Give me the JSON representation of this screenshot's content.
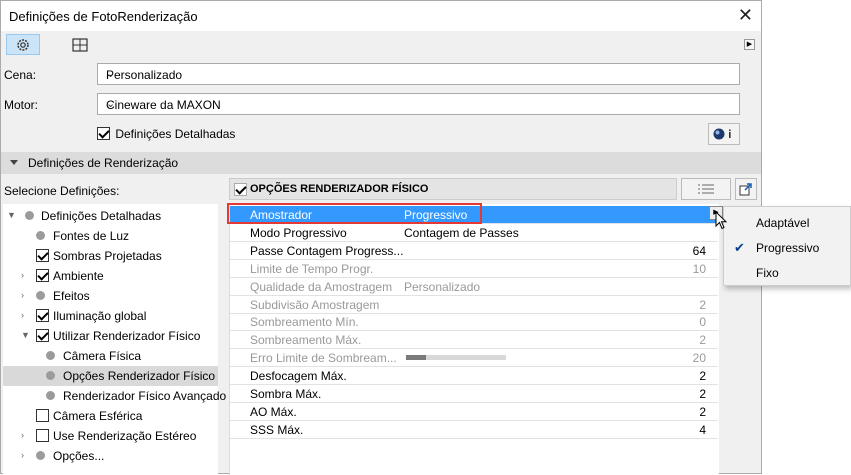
{
  "window": {
    "title": "Definições de FotoRenderização",
    "close_glyph": "✕"
  },
  "toolbar": {
    "icons": [
      "gear-icon",
      "viewport-icon"
    ],
    "scroll_glyph": "▶"
  },
  "scene": {
    "label": "Cena:",
    "value": "Personalizado"
  },
  "engine": {
    "label": "Motor:",
    "value": "Cineware da MAXON"
  },
  "detailed": {
    "label": "Definições Detalhadas",
    "checked": true
  },
  "section": {
    "title": "Definições de Renderização"
  },
  "select_label": "Selecione Definições:",
  "panel_header": {
    "title": "OPÇÕES RENDERIZADOR FÍSICO"
  },
  "tree": [
    {
      "label": "Definições Detalhadas",
      "type": "dot",
      "expander": "▼",
      "level": 0
    },
    {
      "label": "Fontes de Luz",
      "type": "dot",
      "level": 1
    },
    {
      "label": "Sombras Projetadas",
      "type": "check",
      "checked": true,
      "level": 1
    },
    {
      "label": "Ambiente",
      "type": "check",
      "checked": true,
      "expander": "›",
      "level": 1
    },
    {
      "label": "Efeitos",
      "type": "dot",
      "expander": "›",
      "level": 1
    },
    {
      "label": "Iluminação global",
      "type": "check",
      "checked": true,
      "expander": "›",
      "level": 1
    },
    {
      "label": "Utilizar Renderizador Físico",
      "type": "check",
      "checked": true,
      "expander": "▼",
      "level": 1
    },
    {
      "label": "Câmera Física",
      "type": "dot",
      "level": 2
    },
    {
      "label": "Opções Renderizador Físico",
      "type": "dot",
      "level": 2,
      "selected": true
    },
    {
      "label": "Renderizador Físico Avançado",
      "type": "dot",
      "level": 2
    },
    {
      "label": "Câmera Esférica",
      "type": "check",
      "checked": false,
      "level": 1
    },
    {
      "label": "Use Renderização Estéreo",
      "type": "check",
      "checked": false,
      "expander": "›",
      "level": 1
    },
    {
      "label": "Opções...",
      "type": "dot",
      "expander": "›",
      "level": 1
    }
  ],
  "properties": [
    {
      "name": "Amostrador",
      "value": "Progressivo",
      "state": "highlight"
    },
    {
      "name": "Modo Progressivo",
      "value": "Contagem de Passes",
      "state": "normal"
    },
    {
      "name": "Passe Contagem Progress...",
      "number": "64",
      "state": "normal"
    },
    {
      "name": "Limite de Tempo Progr.",
      "number": "10",
      "state": "disabled"
    },
    {
      "name": "Qualidade da Amostragem",
      "value": "Personalizado",
      "state": "disabled"
    },
    {
      "name": "Subdivisão Amostragem",
      "number": "2",
      "state": "disabled"
    },
    {
      "name": "Sombreamento Mín.",
      "number": "0",
      "state": "disabled"
    },
    {
      "name": "Sombreamento Máx.",
      "number": "2",
      "state": "disabled"
    },
    {
      "name": "Erro Limite de Sombream...",
      "number": "20",
      "state": "disabled",
      "slider_fraction": 0.2
    },
    {
      "name": "Desfocagem Máx.",
      "number": "2",
      "state": "normal"
    },
    {
      "name": "Sombra Máx.",
      "number": "2",
      "state": "normal"
    },
    {
      "name": "AO Máx.",
      "number": "2",
      "state": "normal"
    },
    {
      "name": "SSS Máx.",
      "number": "4",
      "state": "normal"
    }
  ],
  "dropdown": {
    "options": [
      {
        "label": "Adaptável",
        "checked": false
      },
      {
        "label": "Progressivo",
        "checked": true
      },
      {
        "label": "Fixo",
        "checked": false
      }
    ],
    "check_glyph": "✔"
  },
  "colors": {
    "highlight": "#3399ff",
    "annotation": "#e53935"
  }
}
